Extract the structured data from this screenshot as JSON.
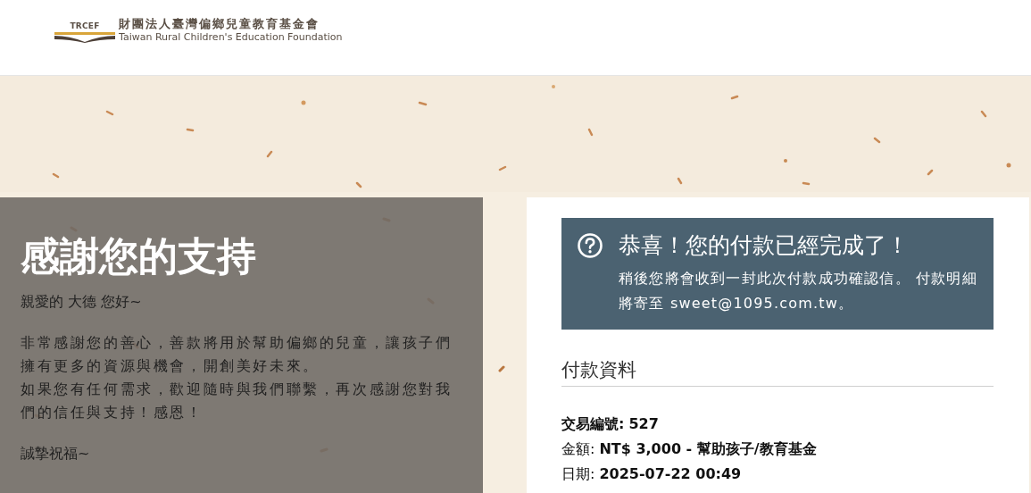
{
  "header": {
    "logo": {
      "mark": "TRCEF",
      "name": "財團法人臺灣偏鄉兒童教育基金會",
      "name_en": "Taiwan Rural Children's Education Foundation"
    }
  },
  "thanks_panel": {
    "title": "感謝您的支持",
    "greeting": "親愛的 大德 您好~",
    "paragraphs": [
      "非常感謝您的善心，善款將用於幫助偏鄉的兒童，讓孩子們擁有更多的資源與機會，開創美好未來。",
      "如果您有任何需求，歡迎隨時與我們聯繫，再次感謝您對我們的信任與支持！感恩！"
    ],
    "closing": "誠摯祝福~"
  },
  "confirmation": {
    "alert": {
      "title": "恭喜！您的付款已經完成了！",
      "message": "稍後您將會收到一封此次付款成功確認信。 付款明細將寄至 sweet@1095.com.tw。"
    },
    "section_title": "付款資料",
    "details": [
      {
        "label": "交易編號:",
        "value": "527",
        "label_bold": true
      },
      {
        "label": "金額:",
        "value": "NT$ 3,000 - 幫助孩子/教育基金",
        "label_bold": false
      },
      {
        "label": "日期:",
        "value": "2025-07-22 00:49",
        "label_bold": false
      }
    ]
  }
}
